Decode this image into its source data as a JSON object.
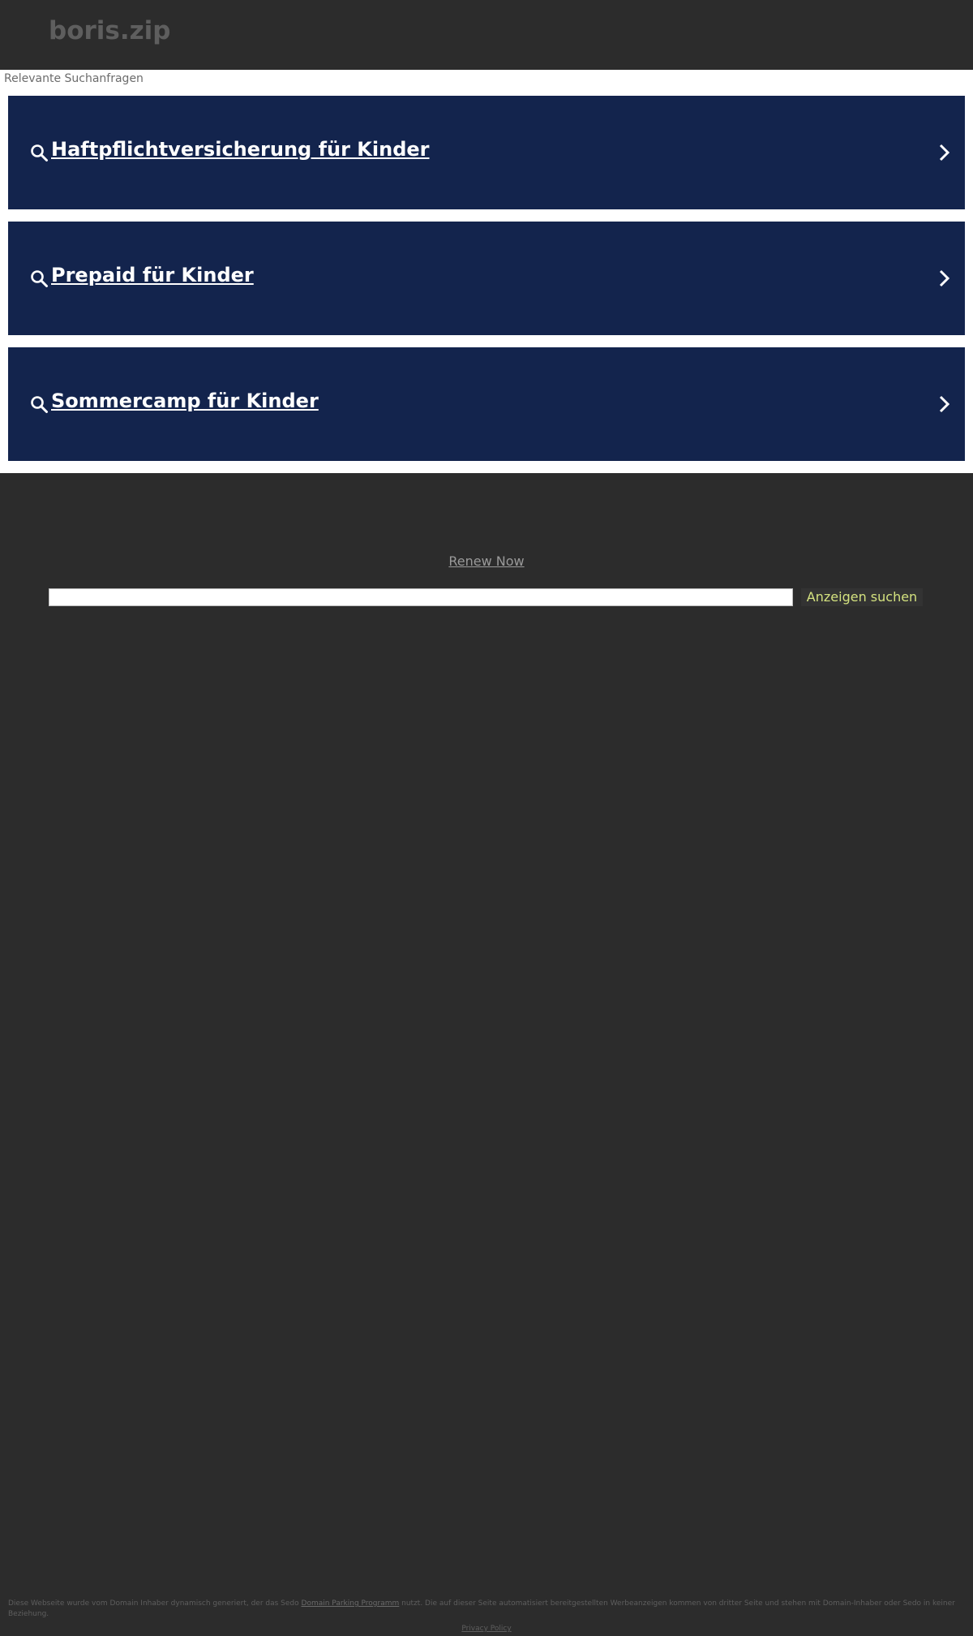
{
  "header": {
    "site_name": "boris.zip"
  },
  "ads": {
    "heading": "Relevante Suchanfragen",
    "items": [
      {
        "label": "Haftpflichtversicherung für Kinder",
        "icon": "search-icon",
        "arrow_icon": "chevron-right-icon"
      },
      {
        "label": "Prepaid für Kinder",
        "icon": "search-icon",
        "arrow_icon": "chevron-right-icon"
      },
      {
        "label": "Sommercamp für Kinder",
        "icon": "search-icon",
        "arrow_icon": "chevron-right-icon"
      }
    ]
  },
  "renew": {
    "label": "Renew Now"
  },
  "search": {
    "value": "",
    "button_label": "Anzeigen suchen"
  },
  "footer": {
    "disclaimer_before": "Diese Webseite wurde vom Domain Inhaber dynamisch generiert, der das Sedo ",
    "disclaimer_link": "Domain Parking Programm",
    "disclaimer_after": " nutzt. Die auf dieser Seite automatisiert bereitgestellten Werbeanzeigen kommen von dritter Seite und stehen mit Domain-Inhaber oder Sedo in keiner Beziehung.",
    "privacy_label": "Privacy Policy"
  },
  "colors": {
    "background": "#2c2c2c",
    "ad_background": "#13244d",
    "ad_text": "#ffffff",
    "search_button_text": "#d4e27f"
  }
}
